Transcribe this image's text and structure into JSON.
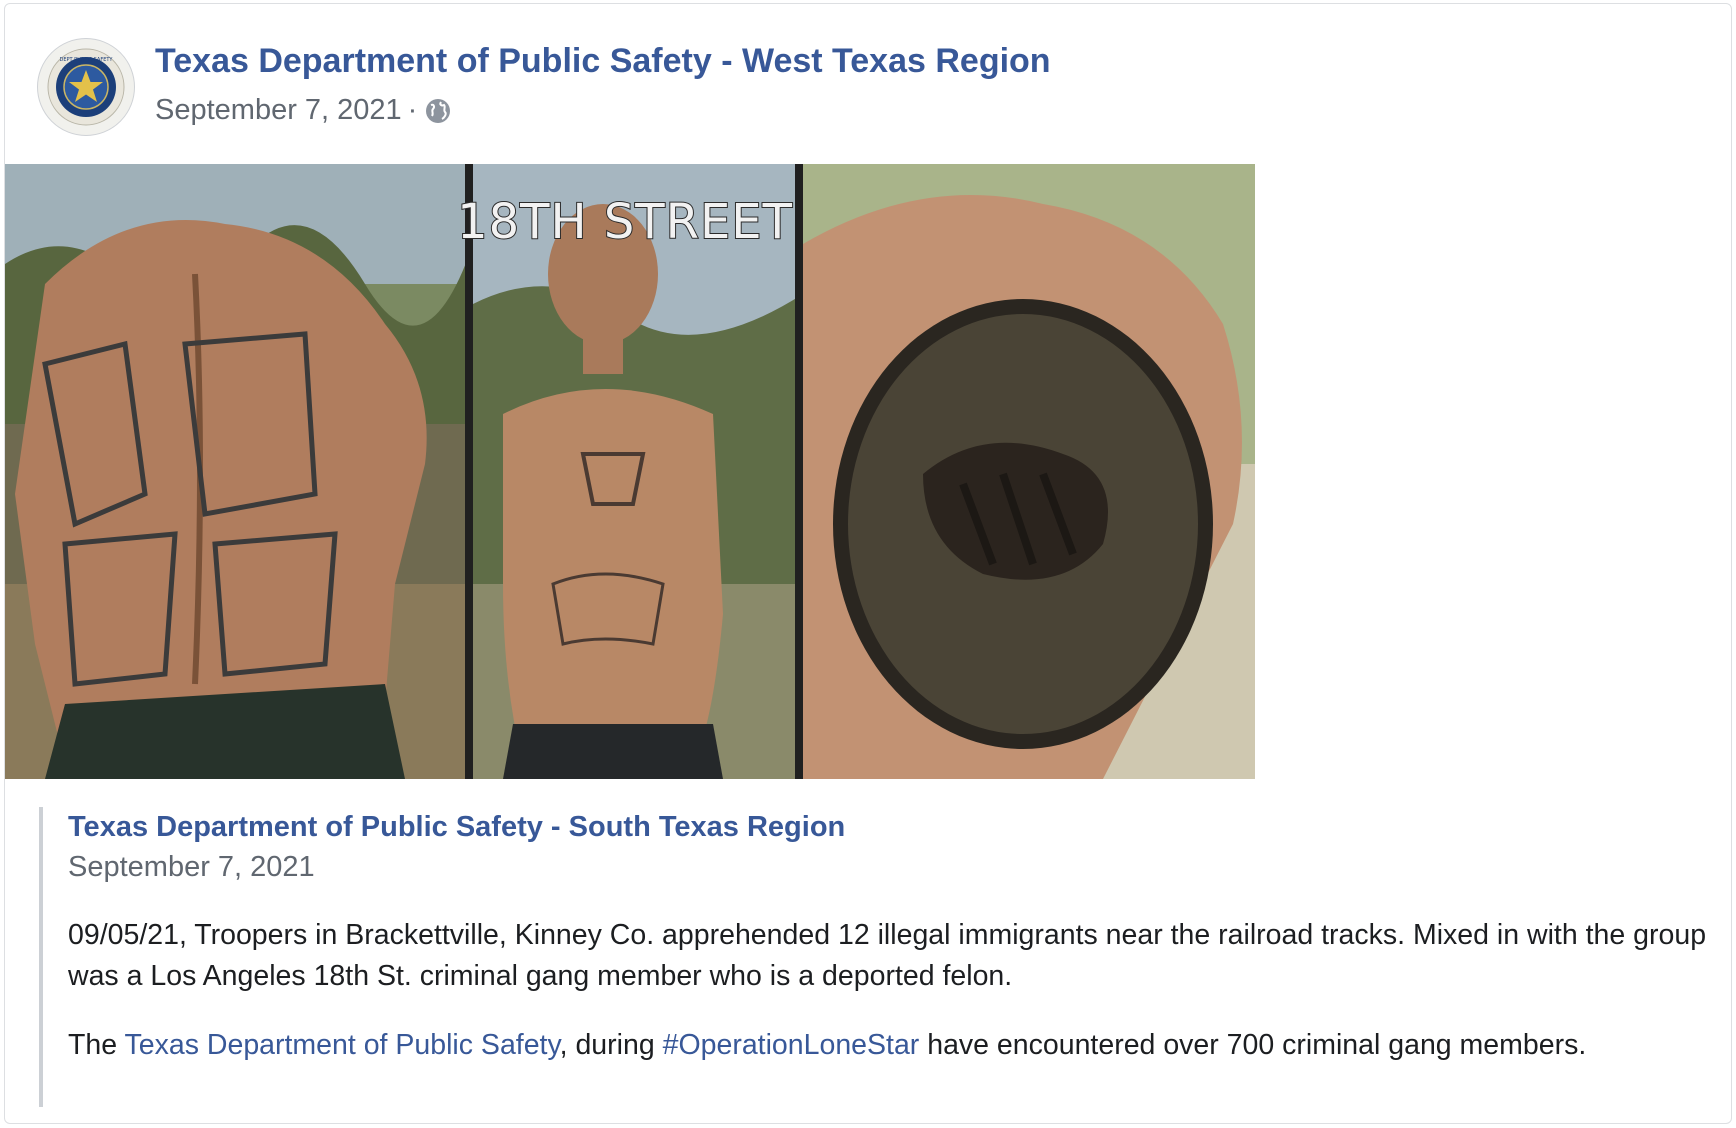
{
  "post": {
    "page_name": "Texas Department of Public Safety - West Texas Region",
    "date": "September 7, 2021",
    "separator": "·",
    "privacy_icon": "globe-icon",
    "avatar_icon": "texas-dps-seal",
    "avatar_seal_letters": [
      "T",
      "E",
      "X",
      "A",
      "S"
    ]
  },
  "photo": {
    "overlay_text": "18TH STREET"
  },
  "shared_post": {
    "page_name": "Texas Department of Public Safety - South Texas Region",
    "date": "September 7, 2021",
    "paragraph1": "09/05/21, Troopers in Brackettville, Kinney Co. apprehended 12 illegal immigrants near the railroad tracks. Mixed in with the group was a Los Angeles 18th St. criminal gang member who is a deported felon.",
    "paragraph2": {
      "prefix": "The ",
      "link1": "Texas Department of Public Safety",
      "middle": ", during ",
      "link2": "#OperationLoneStar",
      "suffix": " have encountered over 700 criminal gang members."
    }
  },
  "colors": {
    "link": "#385898",
    "secondary_text": "#606770",
    "body_text": "#1c1e21",
    "quote_bar": "#ccd0d5"
  }
}
